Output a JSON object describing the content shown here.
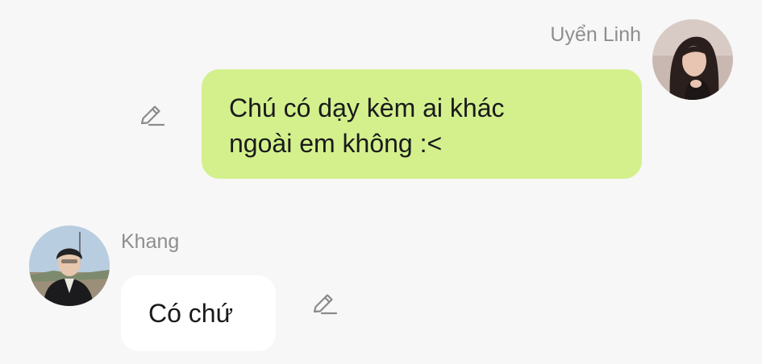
{
  "colors": {
    "background": "#f7f7f7",
    "outgoing_bubble": "#d3f08d",
    "incoming_bubble": "#ffffff",
    "sender_name": "#8e8e8e",
    "message_text": "#1a1a1a",
    "edit_icon": "#8a8a8a"
  },
  "messages": [
    {
      "direction": "outgoing",
      "sender": "Uyển Linh",
      "avatar_icon": "user-avatar-photo",
      "lines": [
        "Chú có dạy kèm ai khác",
        "ngoài em không :<"
      ],
      "action_icon": "pencil-edit-icon"
    },
    {
      "direction": "incoming",
      "sender": "Khang",
      "avatar_icon": "user-avatar-photo",
      "lines": [
        "Có chứ"
      ],
      "action_icon": "pencil-edit-icon"
    }
  ]
}
